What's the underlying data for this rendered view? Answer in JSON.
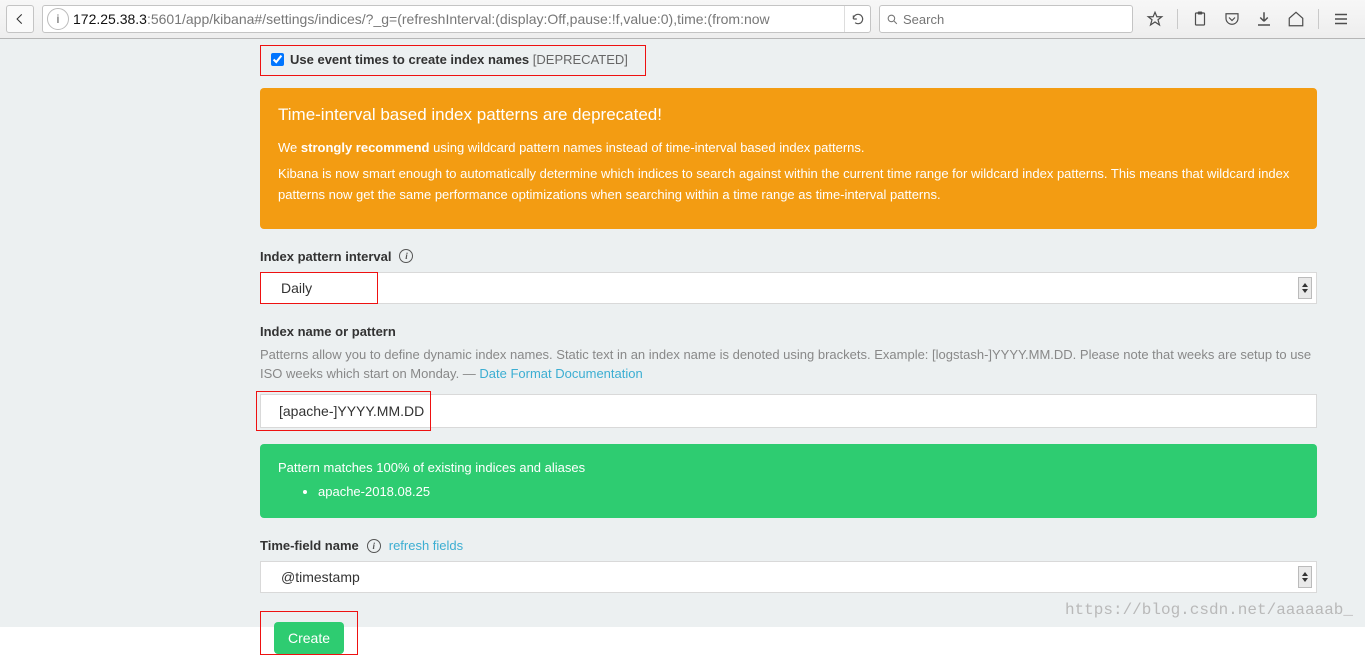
{
  "browser": {
    "url_host": "172.25.38.3",
    "url_rest": ":5601/app/kibana#/settings/indices/?_g=(refreshInterval:(display:Off,pause:!f,value:0),time:(from:now",
    "search_placeholder": "Search"
  },
  "checkbox": {
    "label_bold": "Use event times to create index names",
    "label_suffix": " [DEPRECATED]"
  },
  "alert_deprecated": {
    "title": "Time-interval based index patterns are deprecated!",
    "p1_pre": "We ",
    "p1_strong": "strongly recommend",
    "p1_post": " using wildcard pattern names instead of time-interval based index patterns.",
    "p2": "Kibana is now smart enough to automatically determine which indices to search against within the current time range for wildcard index patterns. This means that wildcard index patterns now get the same performance optimizations when searching within a time range as time-interval patterns."
  },
  "interval": {
    "label": "Index pattern interval",
    "value": "Daily"
  },
  "index_name": {
    "label": "Index name or pattern",
    "hint_pre": "Patterns allow you to define dynamic index names. Static text in an index name is denoted using brackets. Example: [logstash-]YYYY.MM.DD. Please note that weeks are setup to use ISO weeks which start on Monday. — ",
    "hint_link": "Date Format Documentation",
    "value": "[apache-]YYYY.MM.DD"
  },
  "match": {
    "summary": "Pattern matches 100% of existing indices and aliases",
    "items": [
      "apache-2018.08.25"
    ]
  },
  "timefield": {
    "label": "Time-field name",
    "refresh": "refresh fields",
    "value": "@timestamp"
  },
  "actions": {
    "create": "Create"
  },
  "watermark": "https://blog.csdn.net/aaaaaab_"
}
